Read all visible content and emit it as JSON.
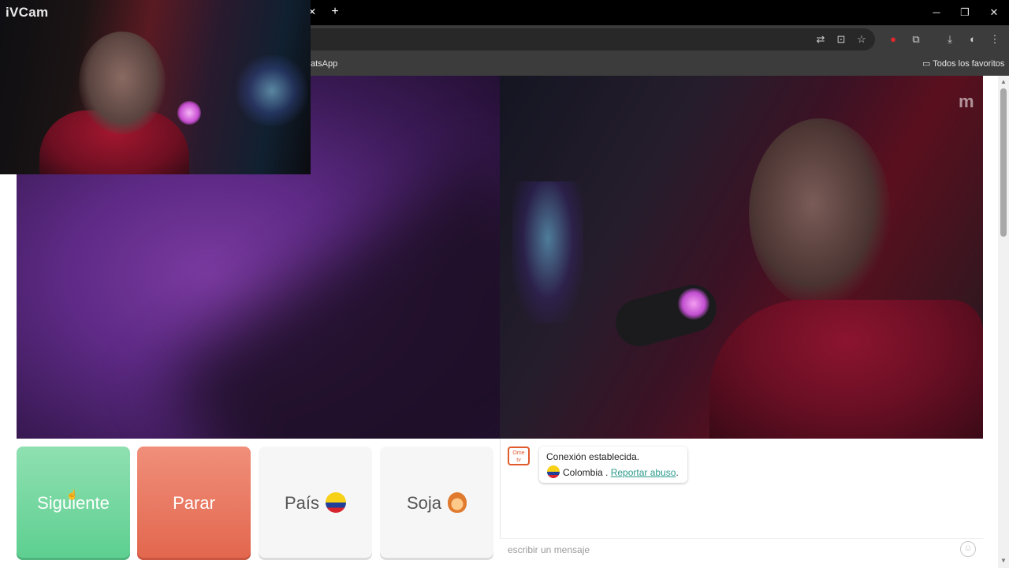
{
  "pip": {
    "label": "iVCam"
  },
  "titlebar": {
    "close_tab": "✕",
    "new_tab": "+",
    "minimize": "─",
    "restore": "❐",
    "close": "✕"
  },
  "toolbar": {
    "icons": [
      "translate-icon",
      "install-icon",
      "star-icon",
      "extension-icon",
      "puzzle-icon",
      "download-icon",
      "profile-icon",
      "menu-icon"
    ]
  },
  "bookmarks": {
    "whatsapp": "atsApp",
    "all_favorites": "Todos los favoritos"
  },
  "buttons": {
    "next": "Siguiente",
    "stop": "Parar",
    "country": "País",
    "gender": "Soja"
  },
  "chat": {
    "logo_top": "Ome",
    "logo_bottom": "tv",
    "status": "Conexión establecida.",
    "country": "Colombia",
    "separator": " . ",
    "report": "Reportar abuso",
    "report_end": ".",
    "placeholder": "escribir un mensaje"
  },
  "video": {
    "watermark": "m"
  },
  "colors": {
    "next": "#5dcf90",
    "stop": "#e2664d",
    "link": "#2a9a8a"
  }
}
